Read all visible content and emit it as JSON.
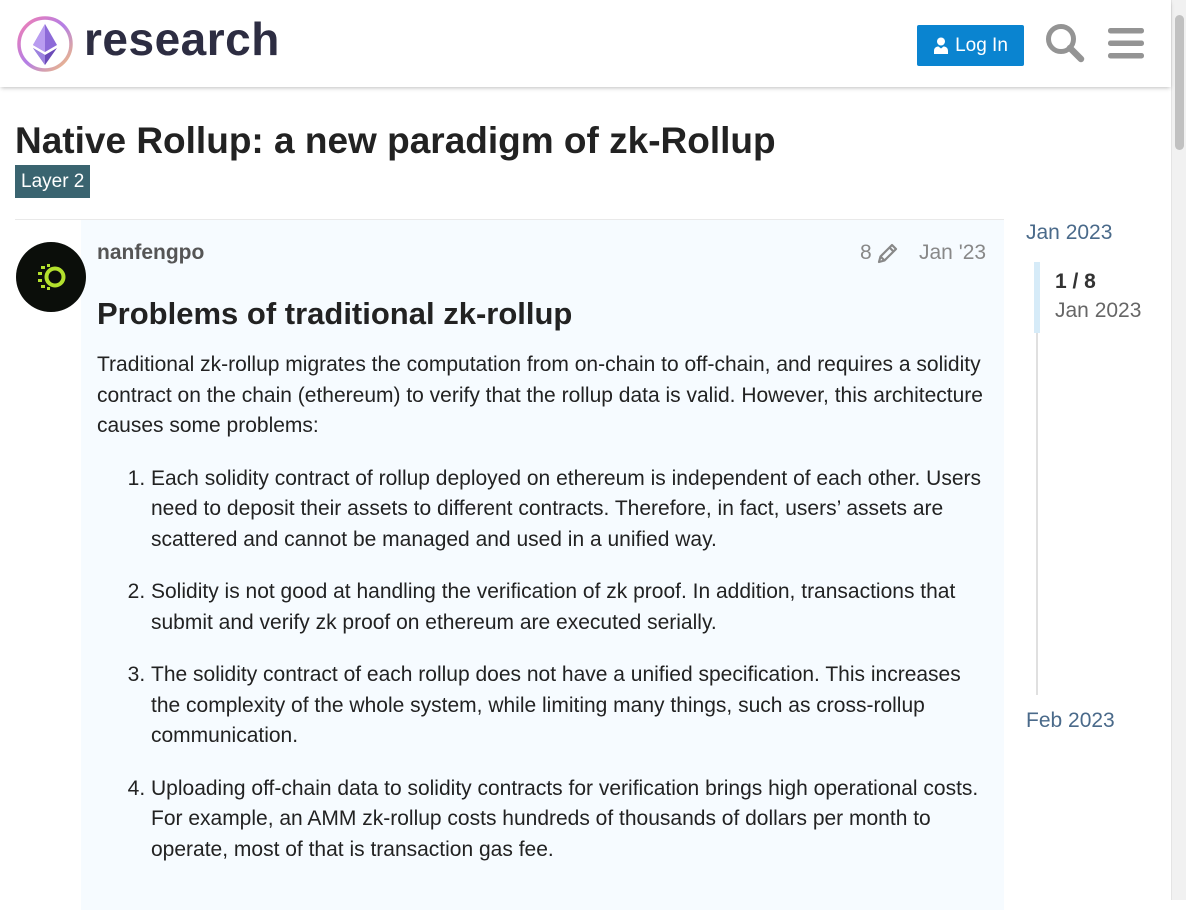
{
  "header": {
    "logo_text": "research",
    "login_label": "Log In",
    "login_icon": "user-icon",
    "search_icon": "search-icon",
    "menu_icon": "hamburger-menu-icon"
  },
  "topic": {
    "title": "Native Rollup: a new paradigm of zk-Rollup",
    "category": "Layer 2",
    "category_color": "#3a6470"
  },
  "post": {
    "username": "nanfengpo",
    "edit_count": "8",
    "edit_icon": "pencil-icon",
    "date": "Jan '23",
    "heading": "Problems of traditional zk-rollup",
    "intro": "Traditional zk-rollup migrates the computation from on-chain to off-chain, and requires a solidity contract on the chain (ethereum) to verify that the rollup data is valid. However, this architecture causes some problems:",
    "items": [
      "Each solidity contract of rollup deployed on ethereum is independent of each other. Users need to deposit their assets to different contracts. Therefore, in fact, users’ assets are scattered and cannot be managed and used in a unified way.",
      "Solidity is not good at handling the verification of zk proof. In addition, transactions that submit and verify zk proof on ethereum are executed serially.",
      "The solidity contract of each rollup does not have a unified specification. This increases the complexity of the whole system, while limiting many things, such as cross-rollup communication.",
      "Uploading off-chain data to solidity contracts for verification brings high operational costs. For example, an AMM zk-rollup costs hundreds of thousands of dollars per month to operate, most of that is transaction gas fee."
    ]
  },
  "timeline": {
    "start_label": "Jan 2023",
    "position": "1 / 8",
    "current_date": "Jan 2023",
    "end_label": "Feb 2023"
  },
  "colors": {
    "accent": "#0a84d0",
    "post_background": "#f6fbff"
  }
}
